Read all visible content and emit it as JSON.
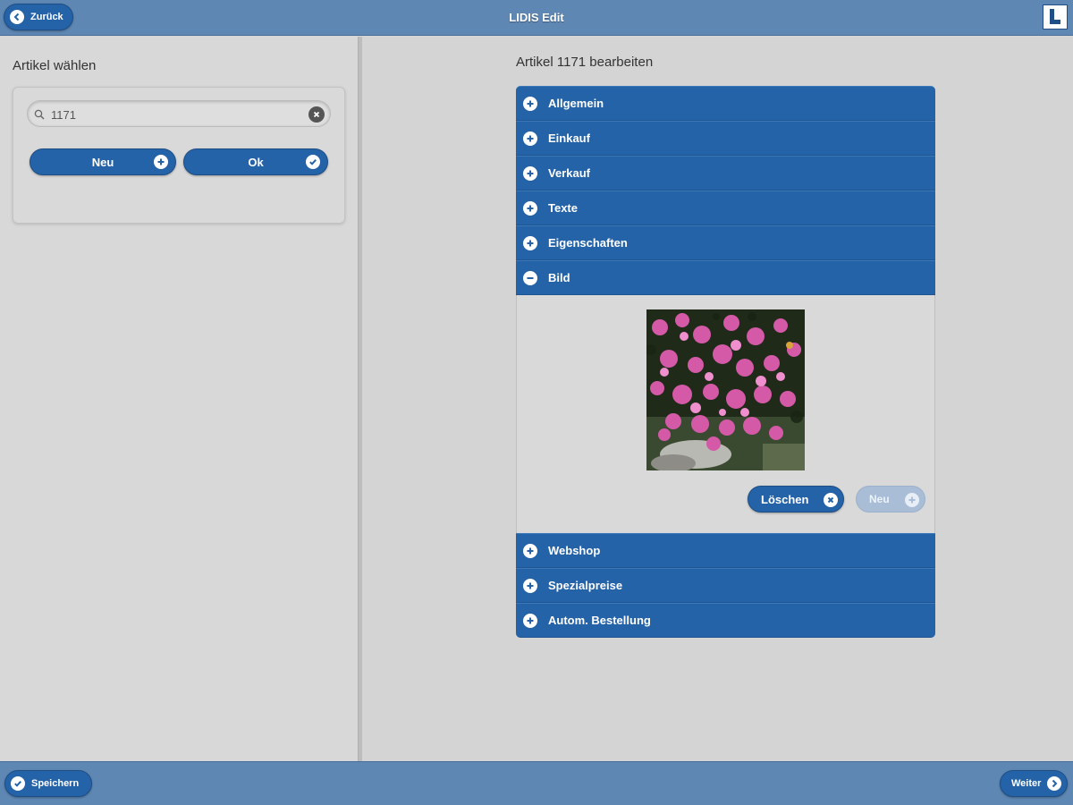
{
  "header": {
    "title": "LIDIS Edit",
    "back_label": "Zurück",
    "logo_letter": "L"
  },
  "left": {
    "title": "Artikel wählen",
    "search": {
      "value": "1171",
      "placeholder": ""
    },
    "new_label": "Neu",
    "ok_label": "Ok"
  },
  "right": {
    "title": "Artikel 1171 bearbeiten",
    "sections": [
      {
        "label": "Allgemein",
        "expanded": false
      },
      {
        "label": "Einkauf",
        "expanded": false
      },
      {
        "label": "Verkauf",
        "expanded": false
      },
      {
        "label": "Texte",
        "expanded": false
      },
      {
        "label": "Eigenschaften",
        "expanded": false
      },
      {
        "label": "Bild",
        "expanded": true
      },
      {
        "label": "Webshop",
        "expanded": false
      },
      {
        "label": "Spezialpreise",
        "expanded": false
      },
      {
        "label": "Autom. Bestellung",
        "expanded": false
      }
    ],
    "image_section": {
      "delete_label": "Löschen",
      "new_label": "Neu",
      "new_disabled": true
    }
  },
  "footer": {
    "save_label": "Speichern",
    "next_label": "Weiter"
  },
  "colors": {
    "bar": "#5e87b3",
    "accent": "#2563a8",
    "background": "#d6d6d6"
  }
}
